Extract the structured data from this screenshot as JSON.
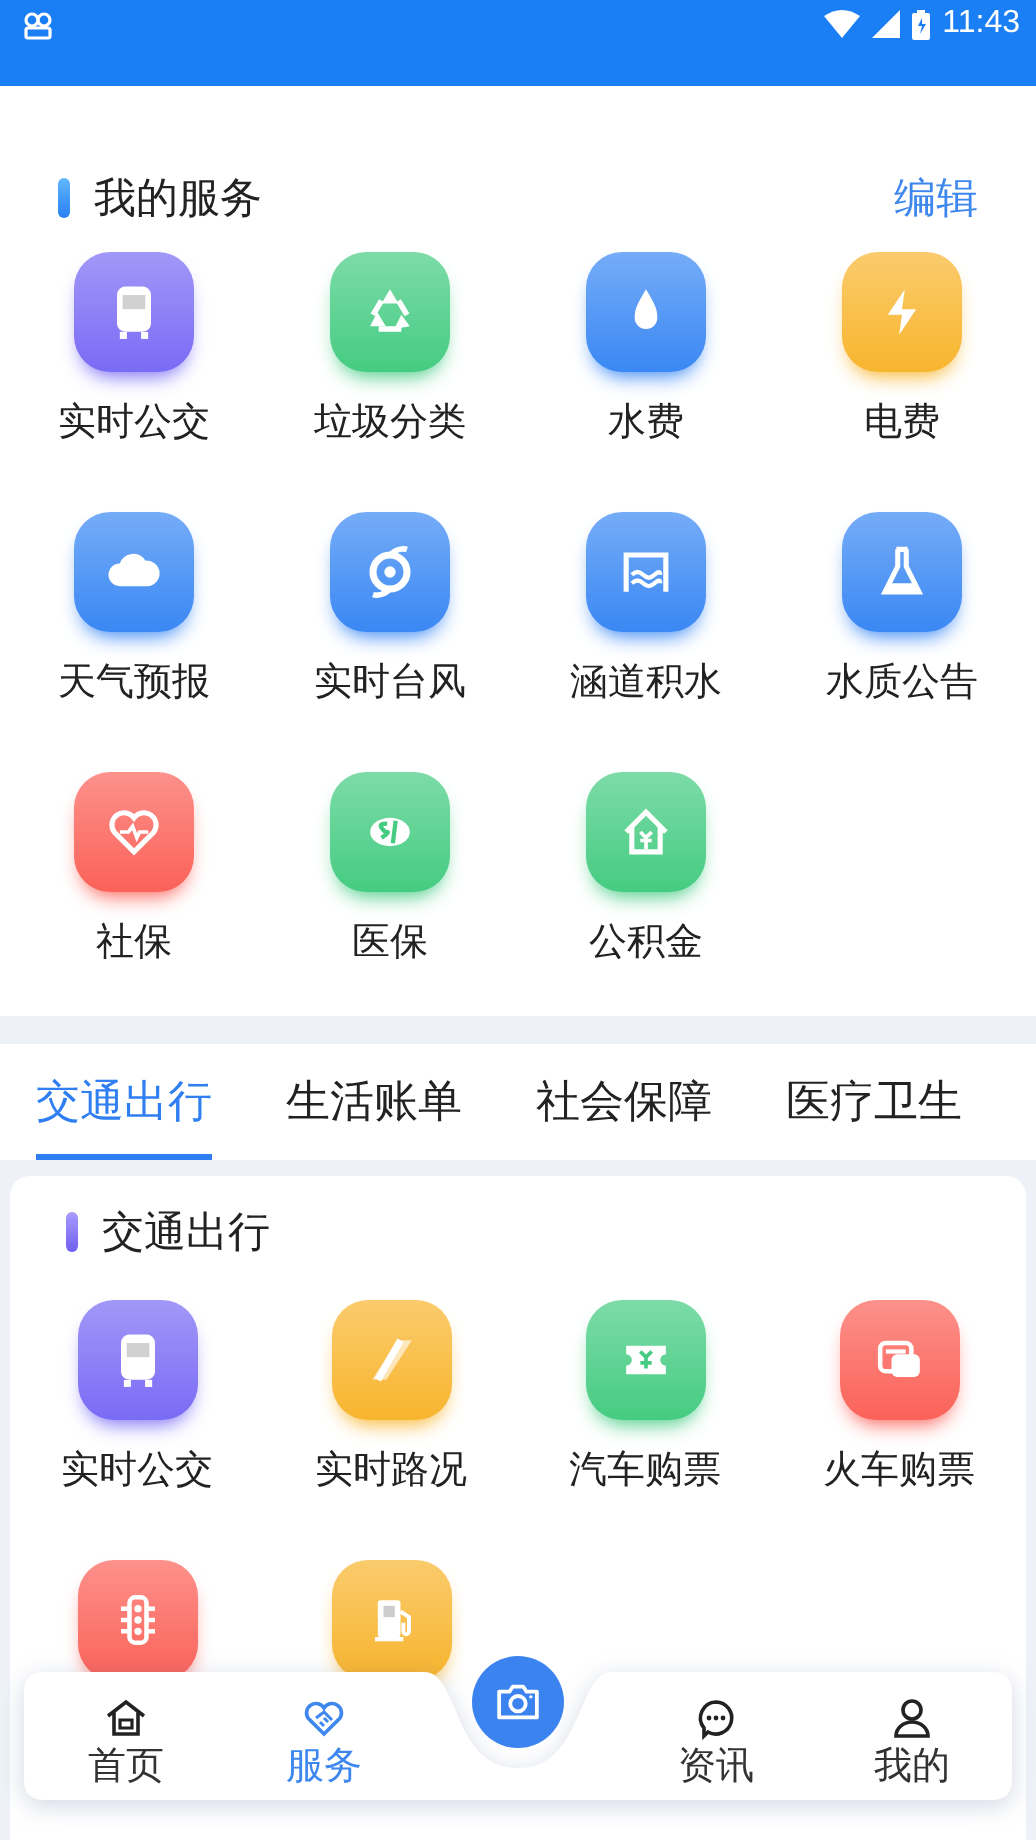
{
  "status_bar": {
    "time": "11:43"
  },
  "my_services": {
    "title": "我的服务",
    "edit": "编辑",
    "items": [
      {
        "label": "实时公交",
        "kind": "bus",
        "color": "#7a6bf5"
      },
      {
        "label": "垃圾分类",
        "kind": "recycle",
        "color": "#45cc82"
      },
      {
        "label": "水费",
        "kind": "drop",
        "color": "#3a88f4"
      },
      {
        "label": "电费",
        "kind": "bolt",
        "color": "#f8b52e"
      },
      {
        "label": "天气预报",
        "kind": "cloud",
        "color": "#3a88f4"
      },
      {
        "label": "实时台风",
        "kind": "typhoon",
        "color": "#3a88f4"
      },
      {
        "label": "涵道积水",
        "kind": "culvert",
        "color": "#3a88f4"
      },
      {
        "label": "水质公告",
        "kind": "flask",
        "color": "#3a88f4"
      },
      {
        "label": "社保",
        "kind": "heart",
        "color": "#fb6259"
      },
      {
        "label": "医保",
        "kind": "si",
        "color": "#45cc82"
      },
      {
        "label": "公积金",
        "kind": "house",
        "color": "#45cc82"
      }
    ]
  },
  "tabs": [
    {
      "label": "交通出行",
      "selected": true
    },
    {
      "label": "生活账单",
      "selected": false
    },
    {
      "label": "社会保障",
      "selected": false
    },
    {
      "label": "医疗卫生",
      "selected": false
    }
  ],
  "category": {
    "title": "交通出行",
    "items": [
      {
        "label": "实时公交",
        "kind": "bus",
        "color": "#7a6bf5"
      },
      {
        "label": "实时路况",
        "kind": "road",
        "color": "#f8b52e"
      },
      {
        "label": "汽车购票",
        "kind": "ticket",
        "color": "#45cc82"
      },
      {
        "label": "火车购票",
        "kind": "train",
        "color": "#fb6259"
      },
      {
        "kind": "traffic-light",
        "color": "#fb6259"
      },
      {
        "kind": "fuel",
        "color": "#f8b52e"
      }
    ]
  },
  "bottom_nav": {
    "items": [
      {
        "label": "首页",
        "kind": "home",
        "selected": false
      },
      {
        "label": "服务",
        "kind": "service",
        "selected": true
      },
      {
        "label": "资讯",
        "kind": "chat",
        "selected": false
      },
      {
        "label": "我的",
        "kind": "person",
        "selected": false
      }
    ]
  }
}
